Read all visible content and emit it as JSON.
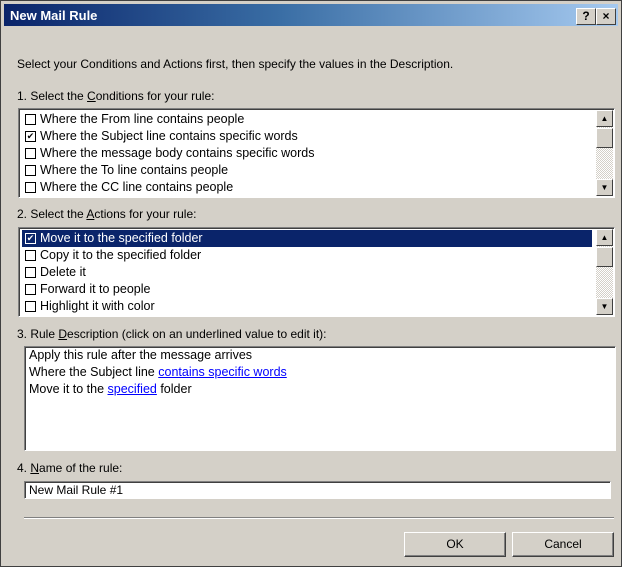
{
  "window": {
    "title": "New Mail Rule",
    "help_label": "?",
    "close_label": "×"
  },
  "instructions": "Select your Conditions and Actions first, then specify the values in the Description.",
  "conditions": {
    "label_pre": "1. Select the ",
    "label_key": "C",
    "label_post": "onditions for your rule:",
    "items": [
      {
        "label": "Where the From line contains people",
        "checked": false,
        "selected": false
      },
      {
        "label": "Where the Subject line contains specific words",
        "checked": true,
        "selected": false
      },
      {
        "label": "Where the message body contains specific words",
        "checked": false,
        "selected": false
      },
      {
        "label": "Where the To line contains people",
        "checked": false,
        "selected": false
      },
      {
        "label": "Where the CC line contains people",
        "checked": false,
        "selected": false
      }
    ]
  },
  "actions": {
    "label_pre": "2. Select the ",
    "label_key": "A",
    "label_post": "ctions for your rule:",
    "items": [
      {
        "label": "Move it to the specified folder",
        "checked": true,
        "selected": true
      },
      {
        "label": "Copy it to the specified folder",
        "checked": false,
        "selected": false
      },
      {
        "label": "Delete it",
        "checked": false,
        "selected": false
      },
      {
        "label": "Forward it to people",
        "checked": false,
        "selected": false
      },
      {
        "label": "Highlight it with color",
        "checked": false,
        "selected": false
      }
    ]
  },
  "description": {
    "label_pre": "3. Rule ",
    "label_key": "D",
    "label_post": "escription (click on an underlined value to edit it):",
    "line1": "Apply this rule after the message arrives",
    "line2_pre": "Where the Subject line ",
    "line2_link": "contains specific words",
    "line3_pre": "Move it to the ",
    "line3_link": "specified",
    "line3_post": " folder"
  },
  "name_field": {
    "label_pre": "4. ",
    "label_key": "N",
    "label_post": "ame of the rule:",
    "value": "New Mail Rule #1"
  },
  "buttons": {
    "ok": "OK",
    "cancel": "Cancel"
  },
  "colors": {
    "selection": "#0a246a",
    "dialog_bg": "#d4d0c8",
    "link": "#0000ff"
  }
}
